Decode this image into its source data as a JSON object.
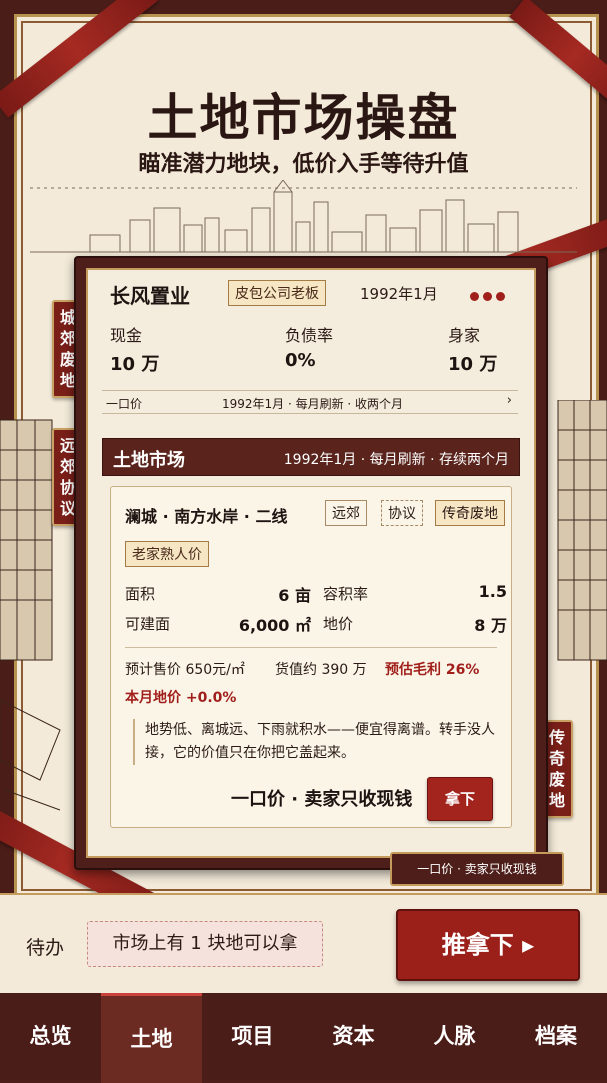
{
  "header": {
    "title": "土地市场操盘",
    "subtitle": "瞄准潜力地块，低价入手等待升值"
  },
  "side_tags": {
    "left_top": "城郊废地",
    "left_bottom": "远郊协议",
    "right": "传奇废地"
  },
  "player": {
    "company": "长风置业",
    "role": "皮包公司老板",
    "date": "1992年1月",
    "cash_label": "现金",
    "cash_value": "10 万",
    "debt_label": "负债率",
    "debt_value": "0%",
    "worth_label": "身家",
    "worth_value": "10 万",
    "ruler_left": "一口价",
    "ruler_mid": "1992年1月 · 每月刷新 · 收两个月"
  },
  "market": {
    "title": "土地市场",
    "subtitle": "1992年1月 · 每月刷新 · 存续两个月"
  },
  "land": {
    "name": "澜城 · 南方水岸 · 二线",
    "tags": [
      "远郊",
      "协议",
      "传奇废地"
    ],
    "local_tag": "老家熟人价",
    "area_label": "面积",
    "area_value": "6 亩",
    "far_label": "容积率",
    "far_value": "1.5",
    "buildable_label": "可建面",
    "buildable_value": "6,000 ㎡",
    "price_label": "地价",
    "price_value": "8 万",
    "est_price": "预计售价 650元/㎡",
    "goods_value": "货值约 390 万",
    "margin": "预估毛利 26%",
    "month_change": "本月地价 +0.0%",
    "description": "地势低、离城远、下雨就积水——便宜得离谱。转手没人接，它的价值只在你把它盖起来。",
    "oneprice": "一口价 · 卖家只收现钱",
    "take_button": "拿下"
  },
  "bottom_label": "一口价 · 卖家只收现钱",
  "todo": {
    "label": "待办",
    "message": "市场上有 1 块地可以拿",
    "push_button": "推拿下 ▸"
  },
  "nav": {
    "items": [
      "总览",
      "土地",
      "项目",
      "资本",
      "人脉",
      "档案"
    ],
    "active": "土地"
  },
  "colors": {
    "accent_red": "#a3231d",
    "frame_brown": "#4e1f1a",
    "paper": "#f3ead9",
    "gold": "#c49a5d"
  }
}
